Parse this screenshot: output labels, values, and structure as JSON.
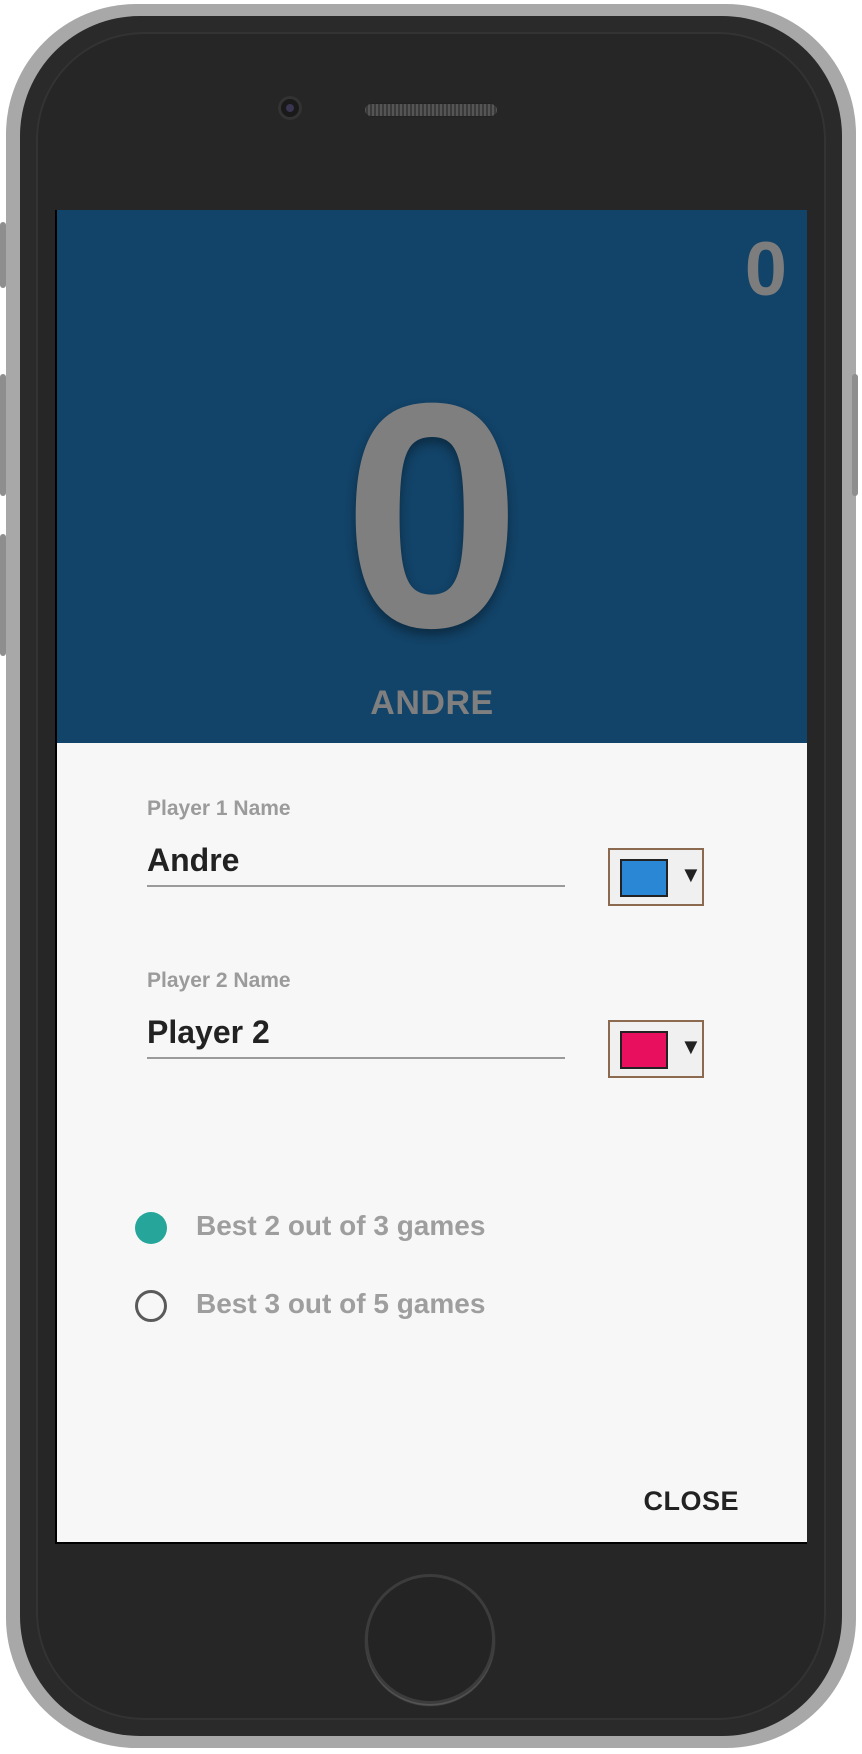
{
  "scoreboard": {
    "secondary_score": "0",
    "main_score": "0",
    "player_name": "ANDRE"
  },
  "settings": {
    "player1": {
      "label": "Player 1 Name",
      "value": "Andre",
      "color": "#2a87d6"
    },
    "player2": {
      "label": "Player 2 Name",
      "value": "Player 2",
      "color": "#e8105e"
    },
    "match_options": [
      {
        "label": "Best 2 out of 3 games",
        "selected": true
      },
      {
        "label": "Best 3 out of 5 games",
        "selected": false
      }
    ],
    "close_label": "CLOSE"
  },
  "colors": {
    "score_panel_bg": "#124368",
    "radio_accent": "#26a69a"
  },
  "icons": {
    "dropdown": "caret-down-icon"
  }
}
